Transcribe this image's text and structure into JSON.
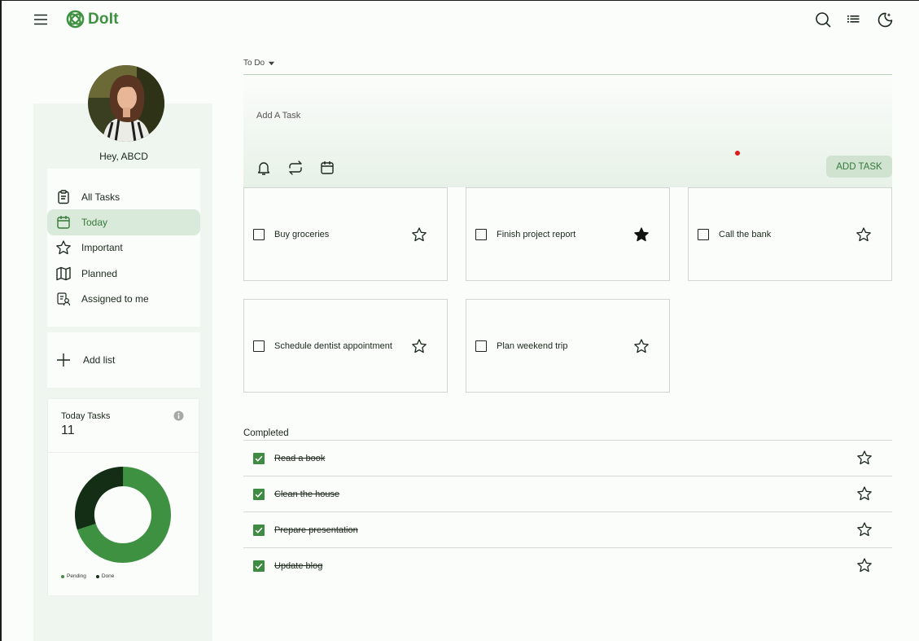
{
  "header": {
    "app_name": "DoIt",
    "brand_color": "#3f9142",
    "icons": [
      "menu-icon",
      "search-icon",
      "list-view-icon",
      "theme-toggle-icon"
    ]
  },
  "sidebar": {
    "greeting": "Hey, ABCD",
    "nav_items": [
      {
        "label": "All Tasks",
        "icon": "clipboard-icon"
      },
      {
        "label": "Today",
        "icon": "calendar-icon",
        "active": true
      },
      {
        "label": "Important",
        "icon": "star-icon"
      },
      {
        "label": "Planned",
        "icon": "map-icon"
      },
      {
        "label": "Assigned to me",
        "icon": "assigned-icon"
      }
    ],
    "add_list_label": "Add list",
    "stats": {
      "label": "Today Tasks",
      "count": "11",
      "legend": [
        {
          "label": "Pending",
          "color": "#3f9142"
        },
        {
          "label": "Done",
          "color": "#142e16"
        }
      ],
      "pending_fraction": 0.7,
      "done_fraction": 0.3
    }
  },
  "main": {
    "list_selector": "To Do",
    "add_task": {
      "placeholder": "Add A Task",
      "button_label": "ADD TASK",
      "tools": [
        "bell-icon",
        "repeat-icon",
        "calendar-icon"
      ]
    },
    "tasks": [
      {
        "title": "Buy groceries",
        "starred": false
      },
      {
        "title": "Finish project report",
        "starred": true
      },
      {
        "title": "Call the bank",
        "starred": false
      },
      {
        "title": "Schedule dentist appointment",
        "starred": false
      },
      {
        "title": "Plan weekend trip",
        "starred": false
      }
    ],
    "completed_label": "Completed",
    "completed": [
      {
        "title": "Read a book"
      },
      {
        "title": "Clean the house"
      },
      {
        "title": "Prepare presentation"
      },
      {
        "title": "Update blog"
      }
    ]
  }
}
